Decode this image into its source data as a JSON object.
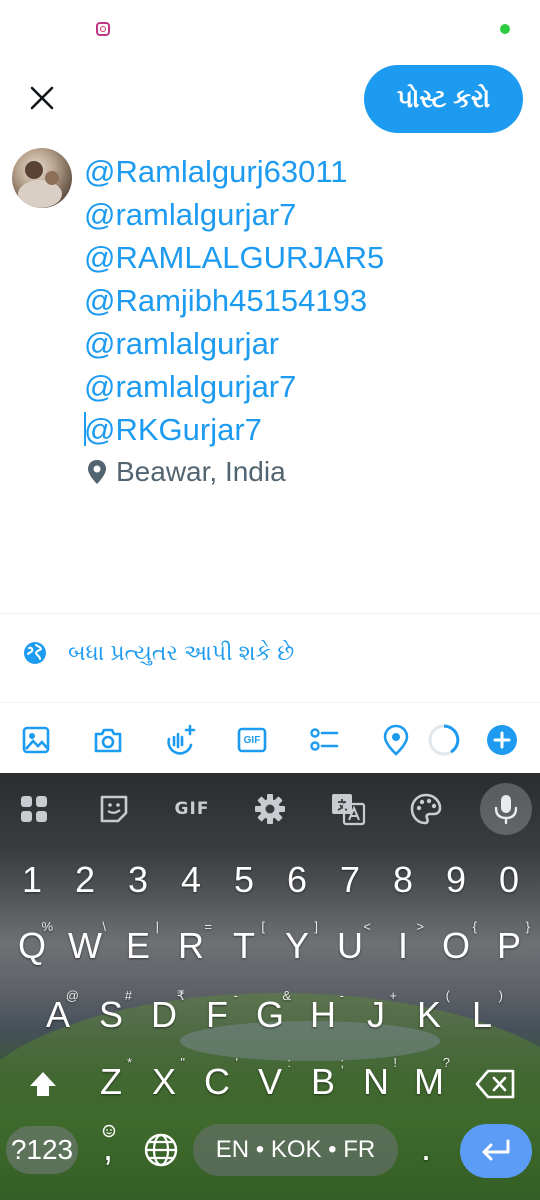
{
  "status_bar": {
    "icons": [
      "instagram-icon",
      "green-dot"
    ]
  },
  "header": {
    "post_label": "પોસ્ટ કરો"
  },
  "composer": {
    "mentions": [
      "@Ramlalgurj63011",
      "@ramlalgurjar7",
      "@RAMLALGURJAR5",
      "@Ramjibh45154193",
      "@ramlalgurjar",
      "@ramlalgurjar7"
    ],
    "last_mention": "@RKGurjar7",
    "location": "Beawar, India"
  },
  "reply_setting": "બધા પ્રત્યુતર આપી શકે છે",
  "toolbar": {
    "gif_label": "GIF"
  },
  "keyboard": {
    "gif_label": "GIF",
    "number_row": [
      "1",
      "2",
      "3",
      "4",
      "5",
      "6",
      "7",
      "8",
      "9",
      "0"
    ],
    "row1": [
      {
        "k": "Q",
        "s": "%"
      },
      {
        "k": "W",
        "s": "\\"
      },
      {
        "k": "E",
        "s": "|"
      },
      {
        "k": "R",
        "s": "="
      },
      {
        "k": "T",
        "s": "["
      },
      {
        "k": "Y",
        "s": "]"
      },
      {
        "k": "U",
        "s": "<"
      },
      {
        "k": "I",
        "s": ">"
      },
      {
        "k": "O",
        "s": "{"
      },
      {
        "k": "P",
        "s": "}"
      }
    ],
    "row2": [
      {
        "k": "A",
        "s": "@"
      },
      {
        "k": "S",
        "s": "#"
      },
      {
        "k": "D",
        "s": "₹"
      },
      {
        "k": "F",
        "s": "-"
      },
      {
        "k": "G",
        "s": "&"
      },
      {
        "k": "H",
        "s": "-"
      },
      {
        "k": "J",
        "s": "+"
      },
      {
        "k": "K",
        "s": "("
      },
      {
        "k": "L",
        "s": ")"
      }
    ],
    "row3": [
      {
        "k": "Z",
        "s": "*"
      },
      {
        "k": "X",
        "s": "\""
      },
      {
        "k": "C",
        "s": "'"
      },
      {
        "k": "V",
        "s": ":"
      },
      {
        "k": "B",
        "s": ";"
      },
      {
        "k": "N",
        "s": "!"
      },
      {
        "k": "M",
        "s": "?"
      }
    ],
    "symbols_label": "?123",
    "comma_label": ",",
    "space_label": "EN • KOK • FR",
    "period_label": "."
  },
  "colors": {
    "accent": "#1d9bf0",
    "secondary_text": "#536471",
    "enter": "#5b9cf6"
  }
}
